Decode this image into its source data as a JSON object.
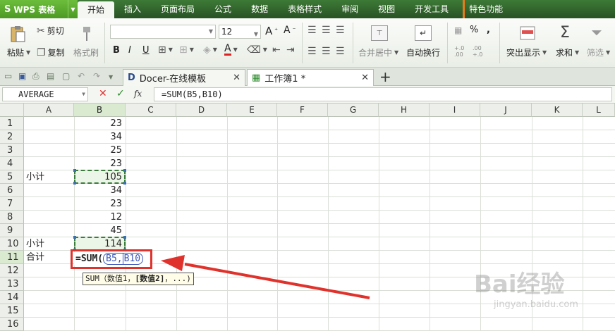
{
  "app": {
    "name": "WPS 表格",
    "logo_glyph": "S"
  },
  "menu": {
    "tabs": [
      "开始",
      "插入",
      "页面布局",
      "公式",
      "数据",
      "表格样式",
      "审阅",
      "视图",
      "开发工具"
    ],
    "feature": "特色功能"
  },
  "ribbon": {
    "paste": "粘贴",
    "cut": "剪切",
    "copy": "复制",
    "format_painter": "格式刷",
    "font_name": "",
    "font_size": "12",
    "merge_center": "合并居中",
    "auto_wrap": "自动换行",
    "percent": "%",
    "comma": ",",
    "inc_decimal": "+.0 .00",
    "dec_decimal": ".00 +.0",
    "highlight": "突出显示",
    "sum": "求和",
    "filter": "筛选"
  },
  "tabs": {
    "doc1": "Docer-在线模板",
    "doc2": "工作簿1 *",
    "close": "✕",
    "new": "+"
  },
  "formula_bar": {
    "name_box": "AVERAGE",
    "cancel": "✕",
    "confirm": "✓",
    "fx": "fx",
    "formula": "=SUM(B5,B10)"
  },
  "grid": {
    "columns": [
      "A",
      "B",
      "C",
      "D",
      "E",
      "F",
      "G",
      "H",
      "I",
      "J",
      "K",
      "L"
    ],
    "rows": [
      "1",
      "2",
      "3",
      "4",
      "5",
      "6",
      "7",
      "8",
      "9",
      "10",
      "11",
      "12",
      "13",
      "14",
      "15",
      "16"
    ],
    "cells": {
      "B1": "23",
      "B2": "34",
      "B3": "25",
      "B4": "23",
      "A5": "小计",
      "B5": "105",
      "B6": "34",
      "B7": "23",
      "B8": "12",
      "B9": "45",
      "A10": "小计",
      "B10": "114",
      "A11": "合计"
    },
    "edit_prefix": "=SUM(",
    "edit_ref1": "B5,",
    "edit_ref2": "B10",
    "tooltip_prefix": "SUM（数值1，",
    "tooltip_bold": "[数值2]",
    "tooltip_suffix": "，...)"
  },
  "watermark": {
    "brand": "Bai经验",
    "url": "jingyan.baidu.com"
  },
  "colors": {
    "menu_bg": "#2f6a2a",
    "accent_green": "#4c9a24",
    "annotation_red": "#e0322c",
    "ref_blue": "#3b55b8"
  }
}
